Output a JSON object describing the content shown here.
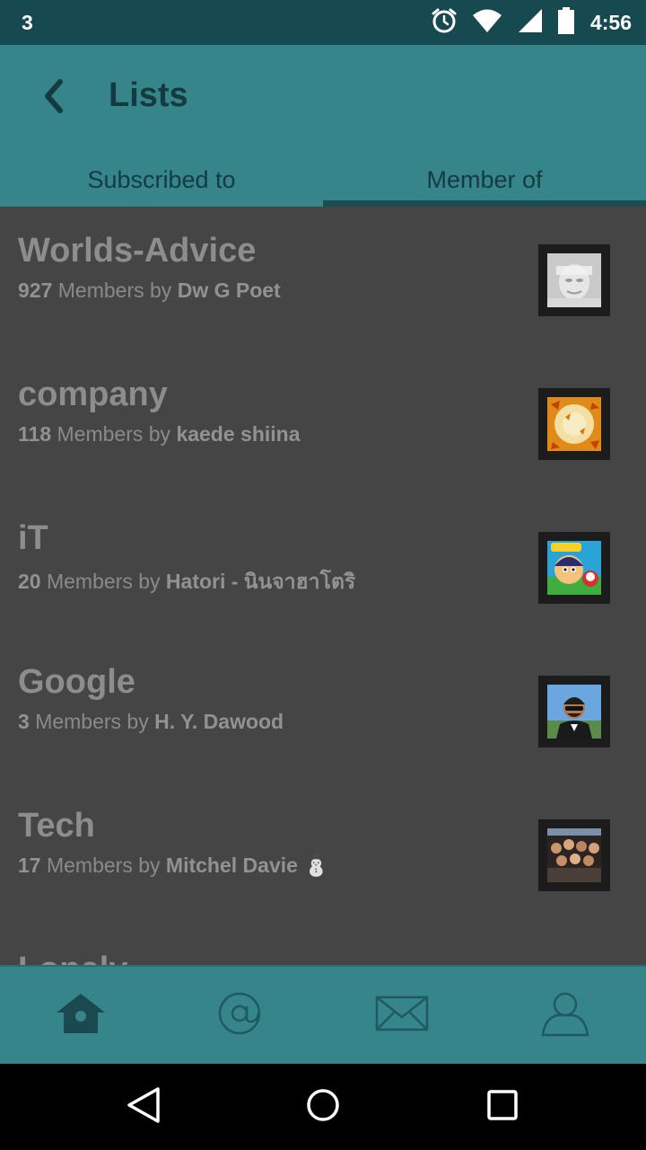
{
  "status_bar": {
    "notification_count": "3",
    "time": "4:56",
    "icons": [
      "alarm-icon",
      "wifi-icon",
      "cell-signal-icon",
      "battery-icon"
    ]
  },
  "header": {
    "title": "Lists",
    "back_icon": "back-chevron-icon"
  },
  "tabs": [
    {
      "label": "Subscribed to",
      "selected": false
    },
    {
      "label": "Member of",
      "selected": true
    }
  ],
  "lists": [
    {
      "name": "Worlds-Advice",
      "count": "927",
      "members_label": "Members by",
      "owner": "Dw G Poet",
      "owner_emoji": ""
    },
    {
      "name": "company",
      "count": "118",
      "members_label": "Members by",
      "owner": "kaede shiina",
      "owner_emoji": ""
    },
    {
      "name": "iT",
      "count": "20",
      "members_label": "Members by",
      "owner": "Hatori - นินจาฮาโตริ",
      "owner_emoji": ""
    },
    {
      "name": "Google",
      "count": "3",
      "members_label": "Members by",
      "owner": "H. Y. Dawood",
      "owner_emoji": ""
    },
    {
      "name": "Tech",
      "count": "17",
      "members_label": "Members by",
      "owner": "Mitchel Davie",
      "owner_emoji": "⛄"
    },
    {
      "name": "Lonely",
      "count": "",
      "members_label": "",
      "owner": "",
      "owner_emoji": ""
    }
  ],
  "bottom_nav": [
    "home-icon",
    "mentions-icon",
    "messages-icon",
    "profile-icon"
  ],
  "system_nav": [
    "back-triangle-icon",
    "home-circle-icon",
    "recents-square-icon"
  ],
  "colors": {
    "status_bar": "#174a50",
    "app_bar": "#35858a",
    "list_bg": "#454545",
    "text_dark": "#153b40"
  }
}
